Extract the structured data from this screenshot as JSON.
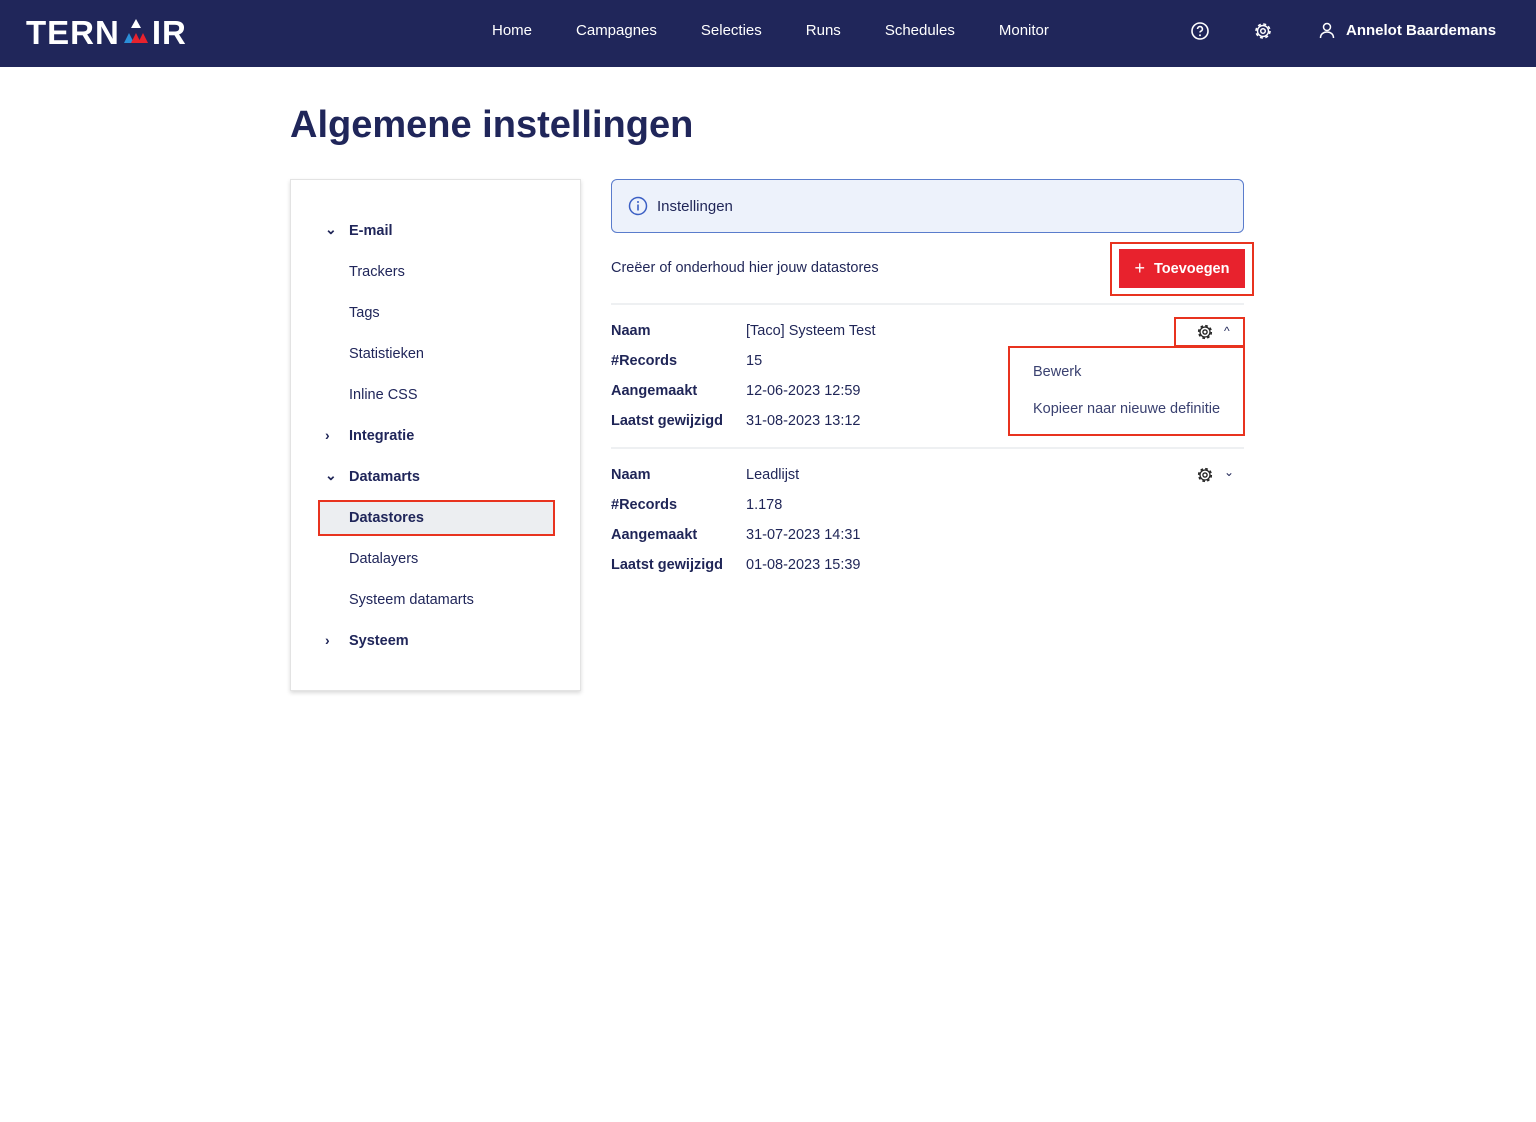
{
  "nav": {
    "logo": "TERNAIR",
    "links": [
      "Home",
      "Campagnes",
      "Selecties",
      "Runs",
      "Schedules",
      "Monitor"
    ],
    "user": "Annelot Baardemans"
  },
  "page_title": "Algemene instellingen",
  "sidebar": {
    "items": [
      {
        "label": "E-mail",
        "bold": true,
        "chevron": "down"
      },
      {
        "label": "Trackers"
      },
      {
        "label": "Tags"
      },
      {
        "label": "Statistieken"
      },
      {
        "label": "Inline CSS"
      },
      {
        "label": "Integratie",
        "bold": true,
        "chevron": "right"
      },
      {
        "label": "Datamarts",
        "bold": true,
        "chevron": "down"
      },
      {
        "label": "Datastores",
        "selected": true
      },
      {
        "label": "Datalayers"
      },
      {
        "label": "Systeem datamarts"
      },
      {
        "label": "Systeem",
        "bold": true,
        "chevron": "right"
      }
    ]
  },
  "info_label": "Instellingen",
  "description": "Creëer of onderhoud hier jouw datastores",
  "add_button": "Toevoegen",
  "labels": {
    "name": "Naam",
    "records": "#Records",
    "created": "Aangemaakt",
    "modified": "Laatst gewijzigd"
  },
  "datastores": [
    {
      "name": "[Taco] Systeem Test",
      "records": "15",
      "created": "12-06-2023 12:59",
      "modified": "31-08-2023 13:12"
    },
    {
      "name": "Leadlijst",
      "records": "1.178",
      "created": "31-07-2023 14:31",
      "modified": "01-08-2023 15:39"
    }
  ],
  "menu": [
    "Bewerk",
    "Kopieer naar nieuwe definitie"
  ],
  "colors": {
    "nav": "#20265a",
    "accent": "#e8222d"
  }
}
